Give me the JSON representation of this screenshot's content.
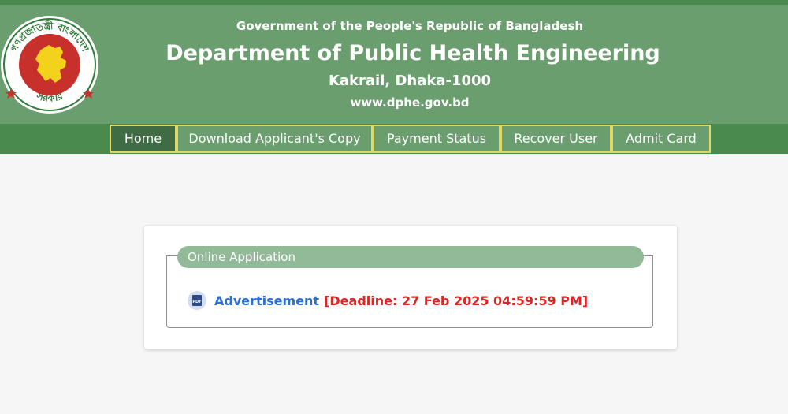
{
  "header": {
    "gov_title": "Government of the People's Republic of Bangladesh",
    "dept_title": "Department of Public Health Engineering",
    "address": "Kakrail, Dhaka-1000",
    "website": "www.dphe.gov.bd",
    "emblem_text_top": "গণপ্রজাতন্ত্রী বাংলাদেশ",
    "emblem_text_bottom": "সরকার",
    "colors": {
      "header_bg": "#6b9e6e",
      "nav_bg": "#4a8a4f",
      "nav_border": "#e0d96a"
    }
  },
  "nav": {
    "items": [
      {
        "label": "Home",
        "active": true
      },
      {
        "label": "Download Applicant's Copy",
        "active": false
      },
      {
        "label": "Payment Status",
        "active": false
      },
      {
        "label": "Recover User",
        "active": false
      },
      {
        "label": "Admit Card",
        "active": false
      }
    ]
  },
  "main": {
    "panel_title": "Online Application",
    "advertisement": {
      "icon": "pdf-icon",
      "link_text": "Advertisement",
      "deadline": "[Deadline: 27 Feb 2025 04:59:59 PM]",
      "link_color": "#2a6fd6",
      "deadline_color": "#e02424"
    }
  }
}
